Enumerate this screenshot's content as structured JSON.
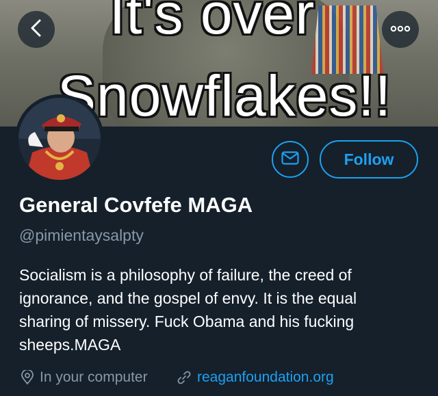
{
  "banner": {
    "line1": "It's over",
    "line2": "Snowflakes!!"
  },
  "profile": {
    "display_name": "General Covfefe MAGA",
    "handle": "@pimientaysalpty",
    "bio_lines": [
      "Socialism is a philosophy of failure, the creed of",
      "ignorance, and the gospel of envy. It is the equal",
      "sharing of missery. Fuck Obama and his fucking",
      "sheeps.MAGA"
    ],
    "location": "In your computer",
    "website": "reaganfoundation.org"
  },
  "actions": {
    "follow_label": "Follow"
  },
  "icons": {
    "back": "chevron-left-icon",
    "more": "more-icon",
    "message": "envelope-icon",
    "location": "location-pin-icon",
    "link": "link-icon"
  },
  "colors": {
    "background": "#15202b",
    "accent": "#1da1f2",
    "secondary_text": "#8899a6"
  }
}
